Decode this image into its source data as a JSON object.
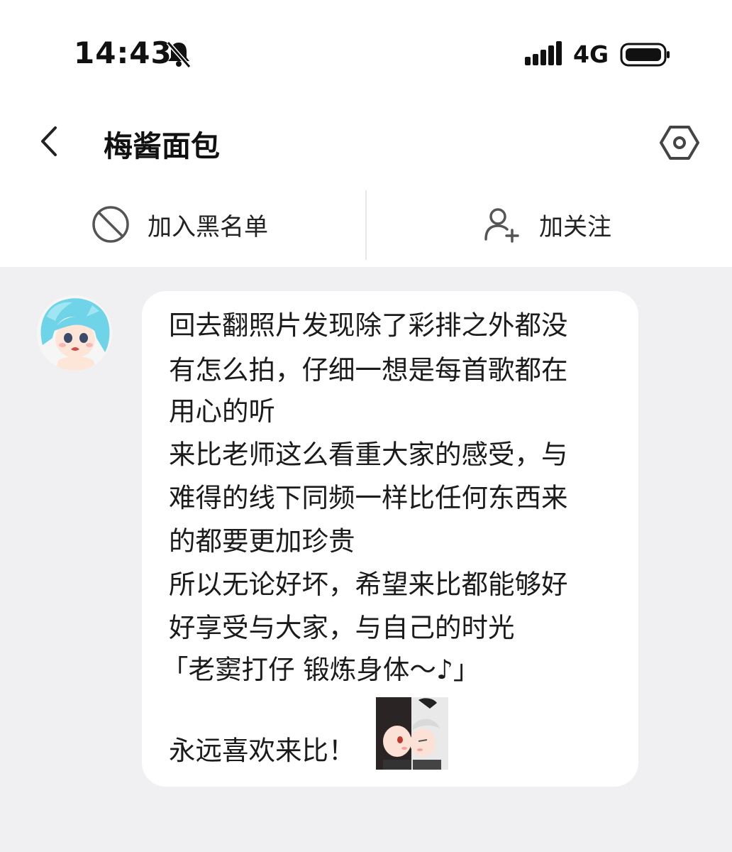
{
  "status_bar": {
    "time": "14:43",
    "network": "4G",
    "icons": [
      "bell-muted-icon",
      "signal-icon",
      "battery-icon"
    ]
  },
  "header": {
    "title": "梅酱面包",
    "back_icon": "chevron-left-icon",
    "settings_icon": "hexagon-settings-icon"
  },
  "actions": {
    "block_label": "加入黑名单",
    "block_icon": "block-icon",
    "follow_label": "加关注",
    "follow_icon": "add-user-icon"
  },
  "message": {
    "lines": [
      "回去翻照片发现除了彩排之外都没",
      "有怎么拍，仔细一想是每首歌都在",
      "用心的听",
      "来比老师这么看重大家的感受，与",
      "难得的线下同频一样比任何东西来",
      "的都要更加珍贵",
      "所以无论好坏，希望来比都能够好",
      "好享受与大家，与自己的时光",
      "「老窦打仔 锻炼身体～♪」",
      "永远喜欢来比！"
    ]
  },
  "colors": {
    "background": "#f0f0f2",
    "surface": "#ffffff",
    "text": "#1a1a1a",
    "icon": "#555555"
  }
}
